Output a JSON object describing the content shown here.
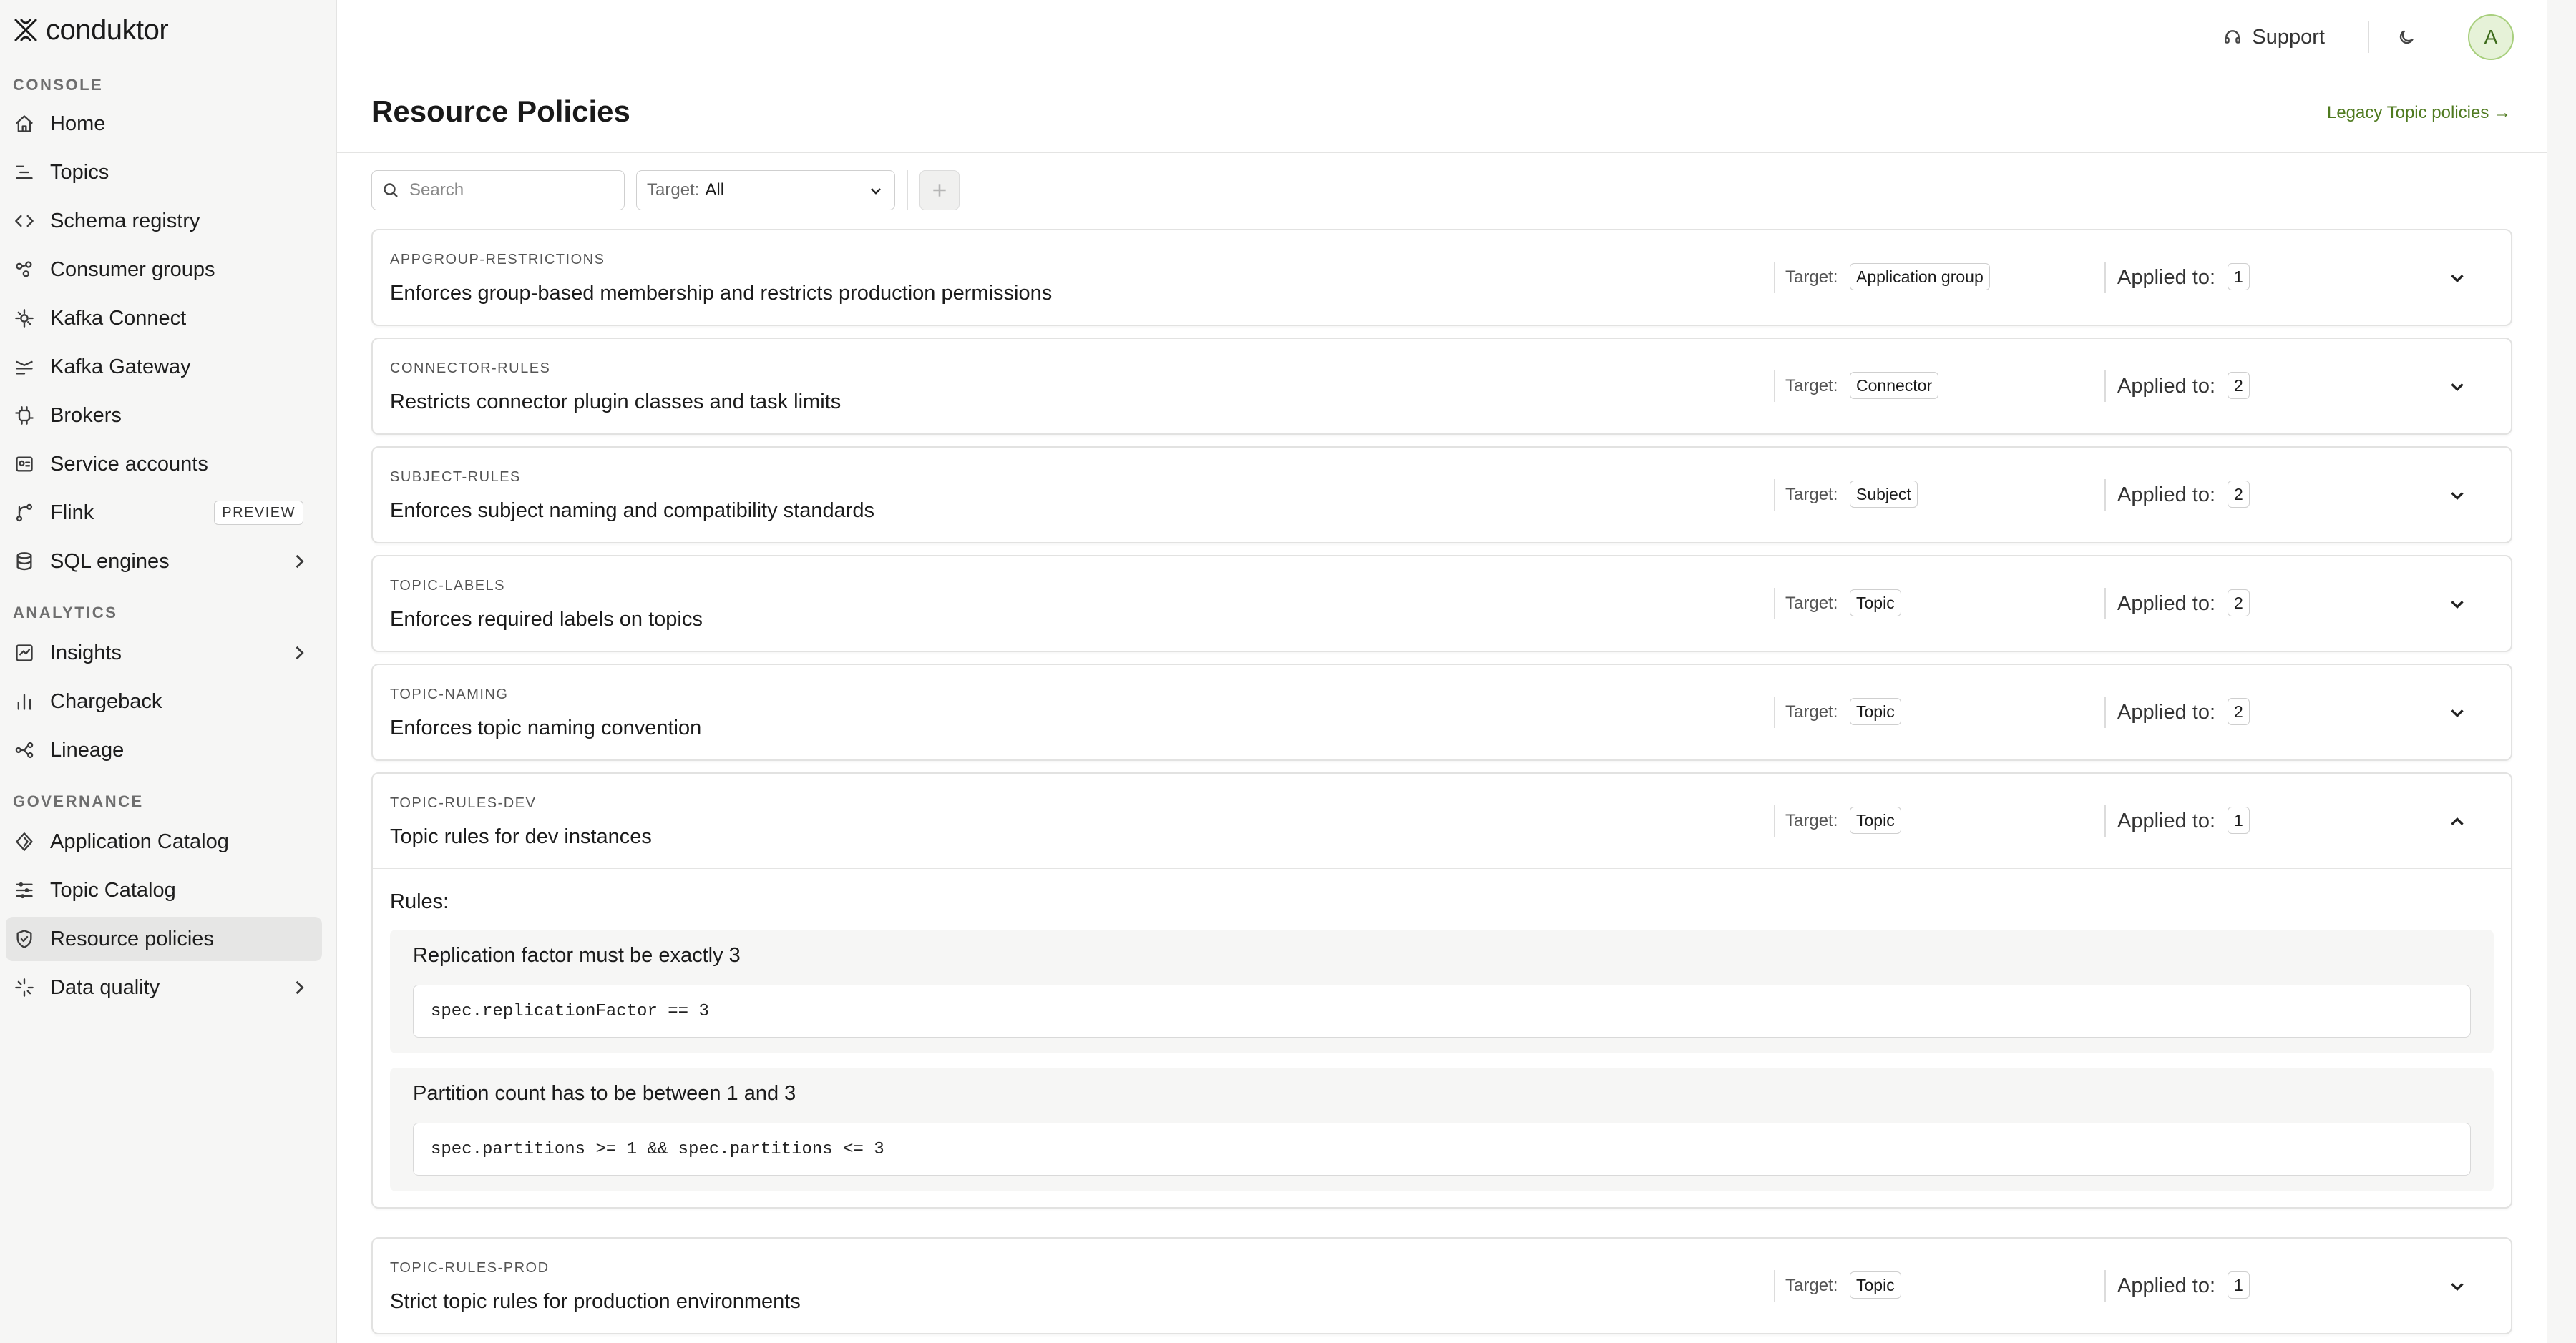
{
  "brand": {
    "name": "conduktor"
  },
  "sidebar": {
    "sections": {
      "console": "CONSOLE",
      "analytics": "ANALYTICS",
      "governance": "GOVERNANCE"
    },
    "items": [
      {
        "label": "Home",
        "icon": "home-icon"
      },
      {
        "label": "Topics",
        "icon": "topics-icon"
      },
      {
        "label": "Schema registry",
        "icon": "code-icon"
      },
      {
        "label": "Consumer groups",
        "icon": "consumer-groups-icon"
      },
      {
        "label": "Kafka Connect",
        "icon": "connect-icon"
      },
      {
        "label": "Kafka Gateway",
        "icon": "gateway-icon"
      },
      {
        "label": "Brokers",
        "icon": "brokers-icon"
      },
      {
        "label": "Service accounts",
        "icon": "service-accounts-icon"
      },
      {
        "label": "Flink",
        "icon": "flink-icon",
        "badge": "PREVIEW"
      },
      {
        "label": "SQL engines",
        "icon": "database-icon"
      },
      {
        "label": "Insights",
        "icon": "insights-icon"
      },
      {
        "label": "Chargeback",
        "icon": "bar-chart-icon"
      },
      {
        "label": "Lineage",
        "icon": "lineage-icon"
      },
      {
        "label": "Application Catalog",
        "icon": "app-catalog-icon"
      },
      {
        "label": "Topic Catalog",
        "icon": "topic-catalog-icon"
      },
      {
        "label": "Resource policies",
        "icon": "shield-icon",
        "active": true
      },
      {
        "label": "Data quality",
        "icon": "data-quality-icon"
      }
    ]
  },
  "topbar": {
    "support_label": "Support",
    "avatar_initial": "A"
  },
  "page": {
    "title": "Resource Policies",
    "legacy_link": "Legacy Topic policies →"
  },
  "toolbar": {
    "search_placeholder": "Search",
    "target_key": "Target:",
    "target_value": "All"
  },
  "labels": {
    "target": "Target:",
    "applied": "Applied to:",
    "rules": "Rules:"
  },
  "policies": [
    {
      "id": "APPGROUP-RESTRICTIONS",
      "description": "Enforces group-based membership and restricts production permissions",
      "target": "Application group",
      "applied": "1"
    },
    {
      "id": "CONNECTOR-RULES",
      "description": "Restricts connector plugin classes and task limits",
      "target": "Connector",
      "applied": "2"
    },
    {
      "id": "SUBJECT-RULES",
      "description": "Enforces subject naming and compatibility standards",
      "target": "Subject",
      "applied": "2"
    },
    {
      "id": "TOPIC-LABELS",
      "description": "Enforces required labels on topics",
      "target": "Topic",
      "applied": "2"
    },
    {
      "id": "TOPIC-NAMING",
      "description": "Enforces topic naming convention",
      "target": "Topic",
      "applied": "2"
    },
    {
      "id": "TOPIC-RULES-DEV",
      "description": "Topic rules for dev instances",
      "target": "Topic",
      "applied": "1",
      "expanded": true,
      "rules": [
        {
          "title": "Replication factor must be exactly 3",
          "expression": "spec.replicationFactor == 3"
        },
        {
          "title": "Partition count has to be between 1 and 3",
          "expression": "spec.partitions >= 1 && spec.partitions <= 3"
        }
      ]
    },
    {
      "id": "TOPIC-RULES-PROD",
      "description": "Strict topic rules for production environments",
      "target": "Topic",
      "applied": "1"
    }
  ],
  "colors": {
    "accent": "#4f7a1f",
    "avatar_bg": "#e6f2d8",
    "active_nav_bg": "#e6e6e5"
  }
}
